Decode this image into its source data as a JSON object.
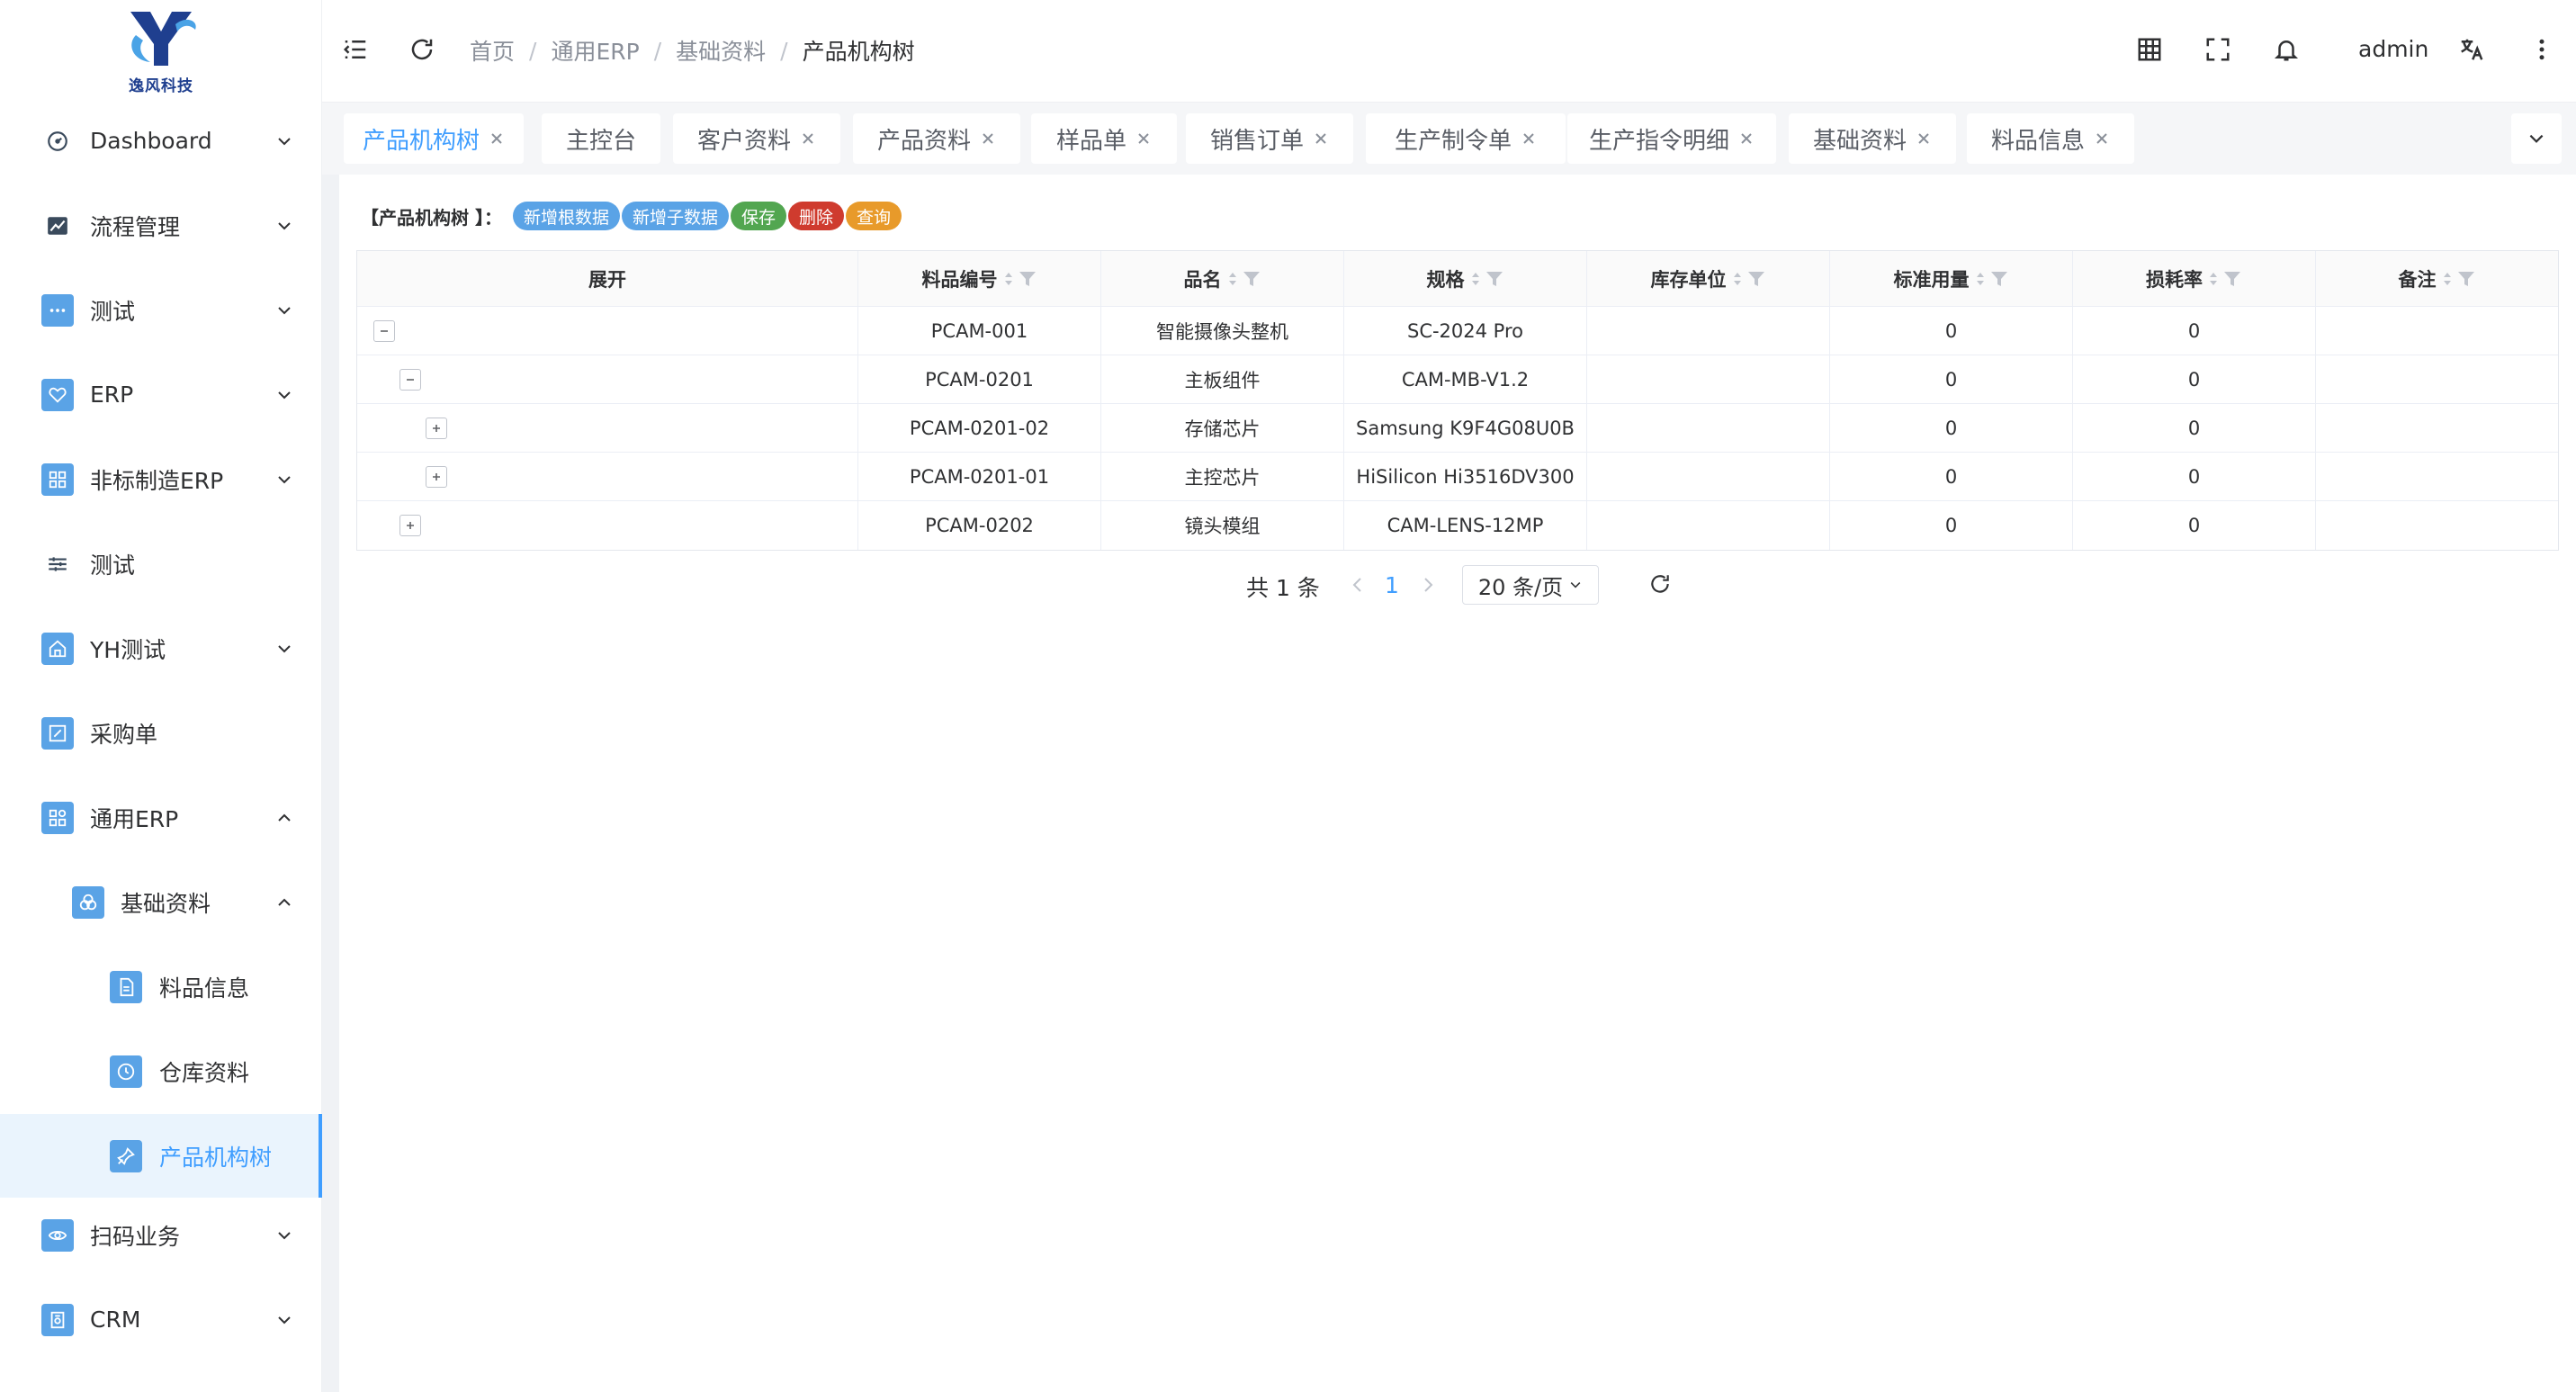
{
  "logo": {
    "text": "逸风科技"
  },
  "sidebar": {
    "items": [
      {
        "label": "Dashboard",
        "icon": "dashboard-icon"
      },
      {
        "label": "流程管理",
        "icon": "chart-icon"
      },
      {
        "label": "测试",
        "icon": "more-icon"
      },
      {
        "label": "ERP",
        "icon": "heart-icon"
      },
      {
        "label": "非标制造ERP",
        "icon": "grid-icon"
      },
      {
        "label": "测试",
        "icon": "sliders-icon"
      },
      {
        "label": "YH测试",
        "icon": "home-icon"
      },
      {
        "label": "采购单",
        "icon": "edit-icon"
      },
      {
        "label": "通用ERP",
        "icon": "apps-icon"
      },
      {
        "label": "基础资料",
        "icon": "circles-icon"
      },
      {
        "label": "料品信息",
        "icon": "document-icon"
      },
      {
        "label": "仓库资料",
        "icon": "clock-icon"
      },
      {
        "label": "产品机构树",
        "icon": "pin-icon"
      },
      {
        "label": "扫码业务",
        "icon": "eye-icon"
      },
      {
        "label": "CRM",
        "icon": "file-icon"
      }
    ]
  },
  "header": {
    "breadcrumb": [
      "首页",
      "通用ERP",
      "基础资料",
      "产品机构树"
    ],
    "user": "admin"
  },
  "tags": [
    {
      "label": "产品机构树",
      "active": true,
      "closable": true
    },
    {
      "label": "主控台",
      "active": false,
      "closable": false
    },
    {
      "label": "客户资料",
      "active": false,
      "closable": true
    },
    {
      "label": "产品资料",
      "active": false,
      "closable": true
    },
    {
      "label": "样品单",
      "active": false,
      "closable": true
    },
    {
      "label": "销售订单",
      "active": false,
      "closable": true
    },
    {
      "label": "生产制令单",
      "active": false,
      "closable": true
    },
    {
      "label": "生产指令明细",
      "active": false,
      "closable": true
    },
    {
      "label": "基础资料",
      "active": false,
      "closable": true
    },
    {
      "label": "料品信息",
      "active": false,
      "closable": true
    }
  ],
  "toolbar": {
    "title": "【产品机构树 】：",
    "buttons": [
      "新增根数据",
      "新增子数据",
      "保存",
      "删除",
      "查询"
    ]
  },
  "table": {
    "columns": [
      "展开",
      "料品编号",
      "品名",
      "规格",
      "库存单位",
      "标准用量",
      "损耗率",
      "备注"
    ],
    "rows": [
      {
        "tree": "−",
        "level": 0,
        "code": "PCAM-001",
        "name": "智能摄像头整机",
        "spec": "SC-2024 Pro",
        "unit": "",
        "qty": "0",
        "loss": "0",
        "remark": ""
      },
      {
        "tree": "−",
        "level": 1,
        "code": "PCAM-0201",
        "name": "主板组件",
        "spec": "CAM-MB-V1.2",
        "unit": "",
        "qty": "0",
        "loss": "0",
        "remark": ""
      },
      {
        "tree": "+",
        "level": 2,
        "code": "PCAM-0201-02",
        "name": "存储芯片",
        "spec": "Samsung K9F4G08U0B",
        "unit": "",
        "qty": "0",
        "loss": "0",
        "remark": ""
      },
      {
        "tree": "+",
        "level": 2,
        "code": "PCAM-0201-01",
        "name": "主控芯片",
        "spec": "HiSilicon Hi3516DV300",
        "unit": "",
        "qty": "0",
        "loss": "0",
        "remark": ""
      },
      {
        "tree": "+",
        "level": 1,
        "code": "PCAM-0202",
        "name": "镜头模组",
        "spec": "CAM-LENS-12MP",
        "unit": "",
        "qty": "0",
        "loss": "0",
        "remark": ""
      }
    ]
  },
  "pager": {
    "total": "共 1 条",
    "page": "1",
    "size": "20 条/页"
  },
  "colors": {
    "accent": "#409eff",
    "btn_blue": "#5aa3e6",
    "btn_green": "#52a650",
    "btn_red": "#cf3b2e",
    "btn_orange": "#e89a2a"
  }
}
